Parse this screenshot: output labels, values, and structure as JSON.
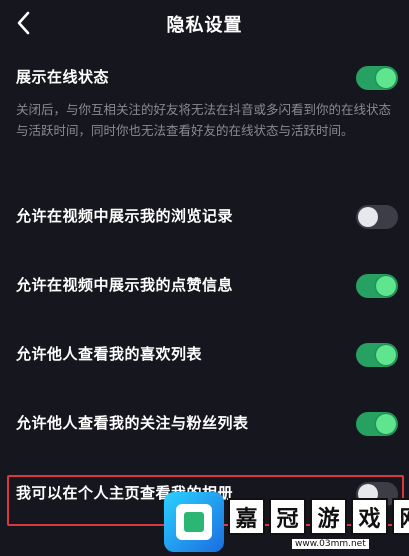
{
  "header": {
    "title": "隐私设置",
    "back_icon": "chevron-left-icon"
  },
  "settings": [
    {
      "label": "展示在线状态",
      "on": true
    },
    {
      "label": "允许在视频中展示我的浏览记录",
      "on": false
    },
    {
      "label": "允许在视频中展示我的点赞信息",
      "on": true
    },
    {
      "label": "允许他人查看我的喜欢列表",
      "on": true
    },
    {
      "label": "允许他人查看我的关注与粉丝列表",
      "on": true
    },
    {
      "label": "我可以在个人主页查看我的相册",
      "on": false
    }
  ],
  "online_desc": "关闭后，与你互相关注的好友将无法在抖音或多闪看到你的在线状态与活跃时间，同时你也无法查看好友的在线状态与活跃时间。",
  "watermark": {
    "chars": [
      "嘉",
      "冠",
      "游",
      "戏",
      "网"
    ],
    "url": "www.03mm.net"
  },
  "colors": {
    "background": "#16161f",
    "toggle_on": "#27a161",
    "toggle_knob_on": "#5ee58e",
    "toggle_off": "#3d3d48",
    "highlight": "#d9393e",
    "desc_text": "#8a8a94"
  }
}
